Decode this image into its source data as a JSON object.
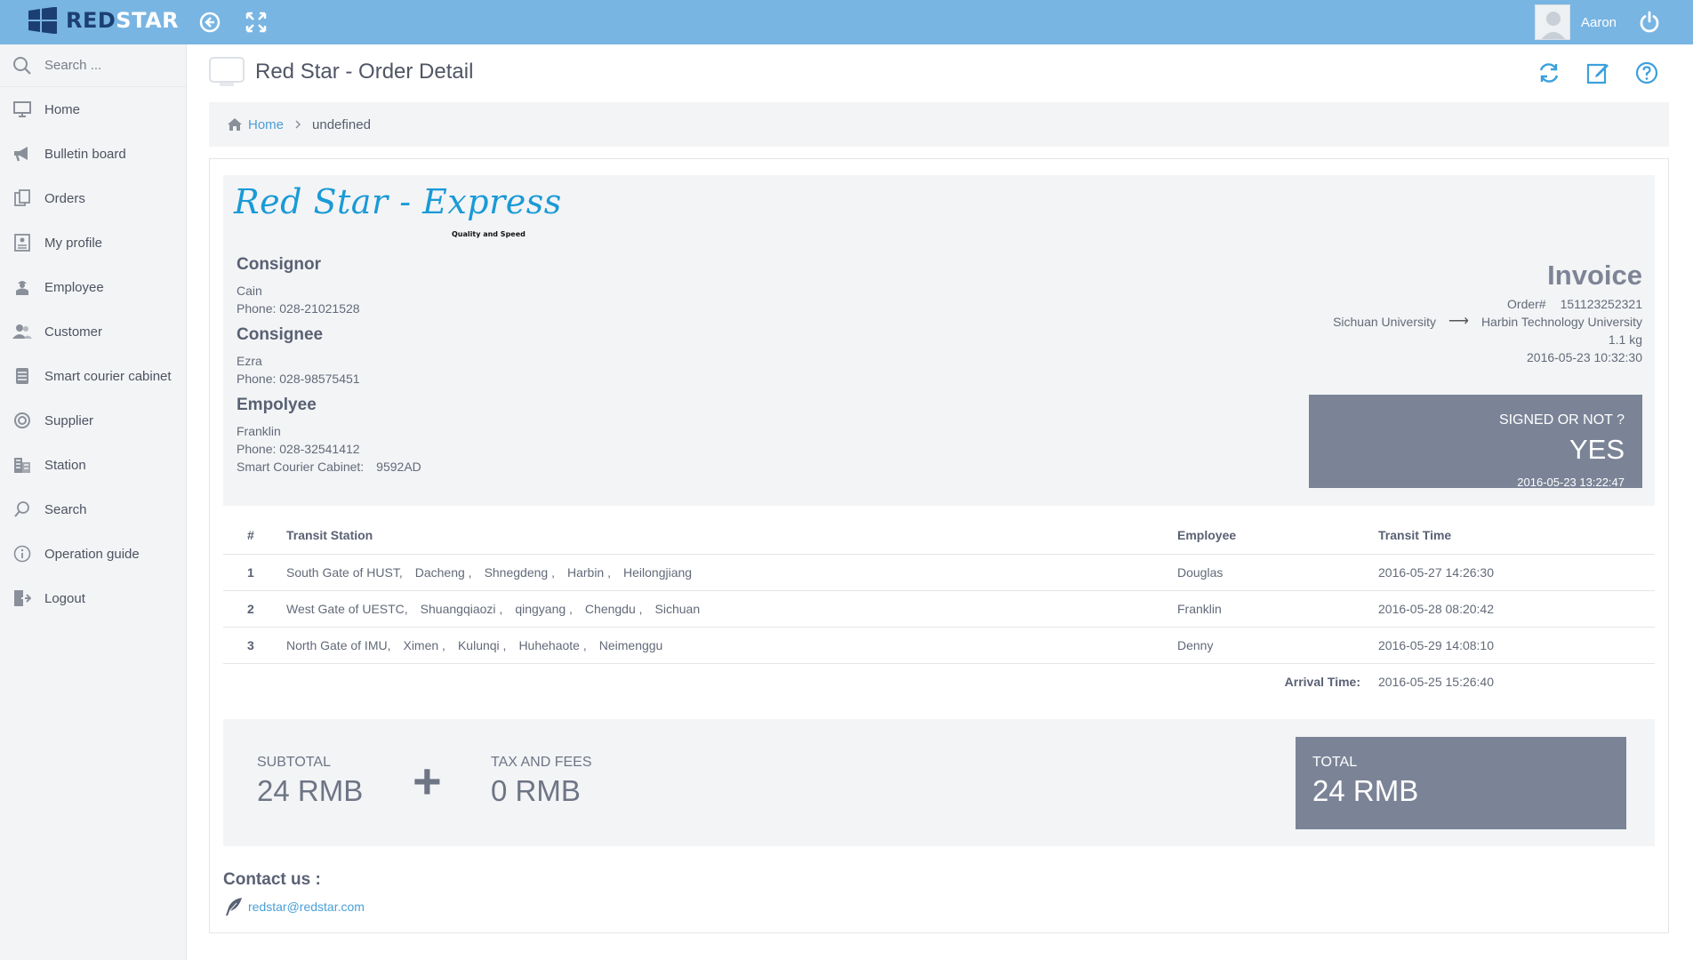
{
  "brand": {
    "part1": "RED",
    "part2": "STAR"
  },
  "user": {
    "name": "Aaron"
  },
  "sidebar": {
    "search_placeholder": "Search ...",
    "items": [
      {
        "label": "Home",
        "icon": "monitor-icon"
      },
      {
        "label": "Bulletin board",
        "icon": "megaphone-icon"
      },
      {
        "label": "Orders",
        "icon": "clipboard-icon"
      },
      {
        "label": "My profile",
        "icon": "id-card-icon"
      },
      {
        "label": "Employee",
        "icon": "worker-icon"
      },
      {
        "label": "Customer",
        "icon": "users-icon"
      },
      {
        "label": "Smart courier cabinet",
        "icon": "cabinet-icon"
      },
      {
        "label": "Supplier",
        "icon": "lifebuoy-icon"
      },
      {
        "label": "Station",
        "icon": "building-icon"
      },
      {
        "label": "Search",
        "icon": "search-icon"
      },
      {
        "label": "Operation guide",
        "icon": "info-icon"
      },
      {
        "label": "Logout",
        "icon": "logout-icon"
      }
    ]
  },
  "page": {
    "title": "Red Star - Order Detail"
  },
  "breadcrumb": {
    "home": "Home",
    "current": "undefined"
  },
  "invoice": {
    "brand_title": "Red Star - Express",
    "brand_subtitle": "Quality and Speed",
    "consignor": {
      "heading": "Consignor",
      "name": "Cain",
      "phone": "Phone: 028-21021528"
    },
    "consignee": {
      "heading": "Consignee",
      "name": "Ezra",
      "phone": "Phone: 028-98575451"
    },
    "employee": {
      "heading": "Empolyee",
      "name": "Franklin",
      "phone": "Phone: 028-32541412",
      "cabinet_label": "Smart Courier Cabinet:",
      "cabinet_value": "9592AD"
    },
    "title": "Invoice",
    "order_label": "Order#",
    "order_number": "151123252321",
    "from": "Sichuan University",
    "arrow": "⟶",
    "to": "Harbin Technology University",
    "weight": "1.1 kg",
    "created": "2016-05-23 10:32:30",
    "signed_question": "SIGNED OR NOT ?",
    "signed_value": "YES",
    "signed_time": "2016-05-23 13:22:47"
  },
  "transit": {
    "headers": [
      "#",
      "Transit Station",
      "Employee",
      "Transit Time"
    ],
    "rows": [
      {
        "num": "1",
        "station": [
          "South Gate of HUST,",
          "Dacheng ,",
          "Shnegdeng ,",
          "Harbin ,",
          "Heilongjiang"
        ],
        "employee": "Douglas",
        "time": "2016-05-27 14:26:30"
      },
      {
        "num": "2",
        "station": [
          "West Gate of UESTC,",
          "Shuangqiaozi ,",
          "qingyang ,",
          "Chengdu ,",
          "Sichuan"
        ],
        "employee": "Franklin",
        "time": "2016-05-28 08:20:42"
      },
      {
        "num": "3",
        "station": [
          "North Gate of IMU,",
          "Ximen ,",
          "Kulunqi ,",
          "Huhehaote ,",
          "Neimenggu"
        ],
        "employee": "Denny",
        "time": "2016-05-29 14:08:10"
      }
    ],
    "arrival_label": "Arrival Time:",
    "arrival_time": "2016-05-25 15:26:40"
  },
  "totals": {
    "subtotal_label": "SUBTOTAL",
    "subtotal_value": "24 RMB",
    "plus": "+",
    "tax_label": "TAX AND FEES",
    "tax_value": "0 RMB",
    "total_label": "TOTAL",
    "total_value": "24 RMB"
  },
  "contact": {
    "heading": "Contact us :",
    "email": "redstar@redstar.com"
  },
  "colors": {
    "topbar": "#78b5e3",
    "accent_blue": "#1a9ad6",
    "panel_gray": "#7b8497",
    "link": "#4a9fd6"
  }
}
